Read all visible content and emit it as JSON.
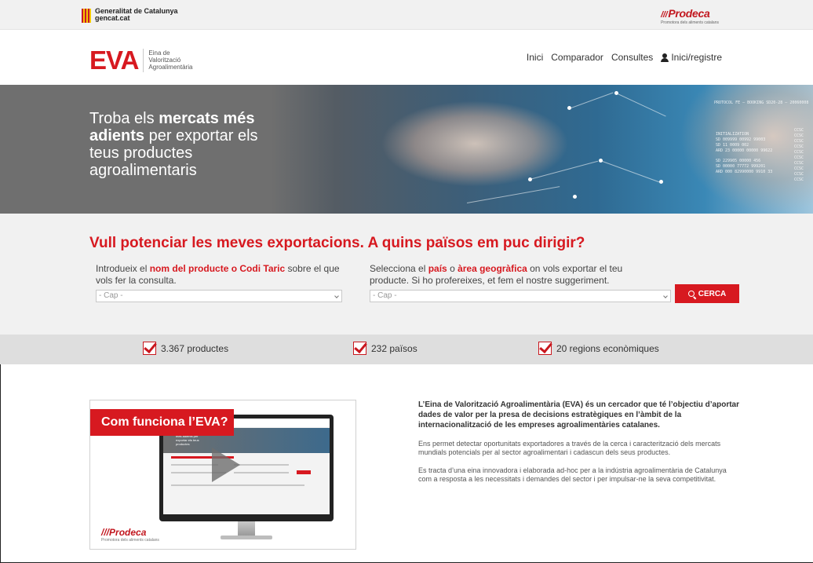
{
  "govbar": {
    "gov_line1": "Generalitat de Catalunya",
    "gov_line2": "gencat.cat",
    "prodeca_name": "Prodeca",
    "prodeca_sub": "Promotora dels aliments catalans"
  },
  "header": {
    "logo": "EVA",
    "logo_sub": [
      "Eina de",
      "Valorització",
      "Agroalimentària"
    ],
    "nav": [
      "Inici",
      "Comparador",
      "Consultes",
      "Inici/registre"
    ]
  },
  "hero": {
    "title_parts": [
      "Troba els ",
      "mercats més adients",
      " per exportar els teus productes agroalimentaris"
    ],
    "data_lines": [
      "PROTOCOL FE — BOOKING SD20-28 — 20060008",
      "INITIALIZATION",
      "SD 009999 00992 99003",
      "SD 11 0009 002",
      "ARD 23 00000 00000 99622",
      "SD 229905 00000 456",
      "SD 00000 77772 999201",
      "ARD 000 82990000 9910 33",
      "CCSC",
      "CCSC",
      "CCSC",
      "CCSC",
      "CCSC",
      "CCSC",
      "CCSC",
      "CCSC",
      "CCSC",
      "CCSC"
    ]
  },
  "search": {
    "title": "Vull potenciar les meves exportacions. A quins països em puc dirigir?",
    "col1_pre": "Introdueix el ",
    "col1_bold": "nom del producte o Codi Taric",
    "col1_post": " sobre el que vols fer la consulta.",
    "col2_pre": "Selecciona el ",
    "col2_bold1": "país",
    "col2_mid": " o ",
    "col2_bold2": "àrea geogràfica",
    "col2_post": " on vols exportar el teu producte. Si ho profereixes, et fem el nostre suggeriment.",
    "select1_value": "- Cap -",
    "select2_value": "- Cap -",
    "button_label": "CERCA"
  },
  "stats": [
    {
      "label": "3.367 productes"
    },
    {
      "label": "232 països"
    },
    {
      "label": "20 regions econòmiques"
    }
  ],
  "video": {
    "banner": "Com funciona l’EVA?",
    "screen_text": "Troba els mercats més adients per exportar els teus productes",
    "prodeca_name": "Prodeca",
    "prodeca_sub": "Promotora dels aliments catalans"
  },
  "info": {
    "lead": "L’Eina de Valorització Agroalimentària (EVA) és un cercador que té l’objectiu d’aportar dades de valor per la presa de decisions estratègiques en l’àmbit de la internacionalització de les empreses agroalimentàries catalanes.",
    "p1": "Ens permet detectar oportunitats exportadores a través de la cerca i caracterització dels mercats mundials potencials per al sector agroalimentari i cadascun dels seus productes.",
    "p2": "Es tracta d’una eina innovadora i elaborada ad-hoc per a la indústria agroalimentària de Catalunya com a resposta a les necessitats i demandes del sector i per impulsar-ne la seva competitivitat."
  }
}
